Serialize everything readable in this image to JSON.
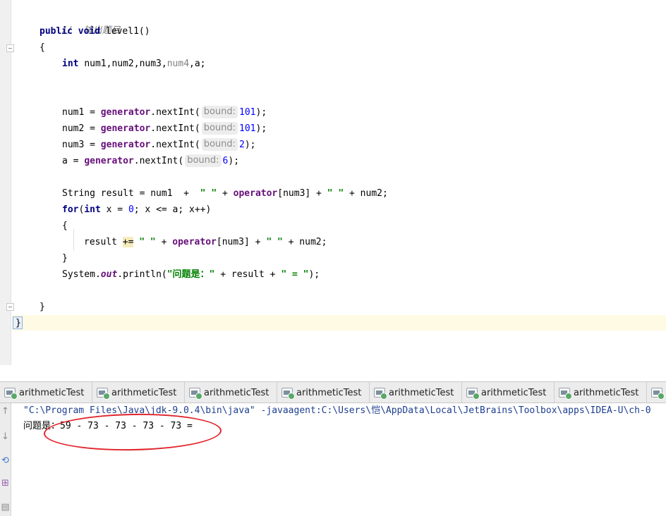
{
  "editor": {
    "comment": "//  输出题目",
    "method_decl": {
      "kw1": "public",
      "kw2": "void",
      "name": "level1()"
    },
    "open_brace": "{",
    "decl": {
      "type": "int",
      "vars": "num1,num2,num3,",
      "unused": "num4",
      "tail": ",a;"
    },
    "gen_lines": [
      {
        "lhs": "num1 = ",
        "field": "generator",
        "call": ".nextInt(",
        "hint": "bound:",
        "value": "101",
        "end": ");"
      },
      {
        "lhs": "num2 = ",
        "field": "generator",
        "call": ".nextInt(",
        "hint": "bound:",
        "value": "101",
        "end": ");"
      },
      {
        "lhs": "num3 = ",
        "field": "generator",
        "call": ".nextInt(",
        "hint": "bound:",
        "value": "2",
        "end": ");"
      },
      {
        "lhs": "a = ",
        "field": "generator",
        "call": ".nextInt(",
        "hint": "bound:",
        "value": "6",
        "end": ");"
      }
    ],
    "result_line": {
      "p1": "String result = num1  + ",
      "s1": " \" \" ",
      "p2": "+ ",
      "field": "operator",
      "p3": "[num3] + ",
      "s2": "\" \"",
      "p4": " + num2;"
    },
    "for_line": {
      "kw": "for",
      "p1": "(",
      "kw2": "int",
      "p2": " x = ",
      "n1": "0",
      "p3": "; x <= a; x++)"
    },
    "for_open": "{",
    "loop_body": {
      "p1": "result ",
      "op": "+=",
      "s1": " \" \" ",
      "p2": "+ ",
      "field": "operator",
      "p3": "[num3] + ",
      "s2": "\" \"",
      "p4": " + num2;"
    },
    "for_close": "}",
    "print_line": {
      "p1": "System.",
      "stat": "out",
      "p2": ".println(",
      "s1": "\"问题是：\"",
      "p3": " + result + ",
      "s2": "\" = \"",
      "p4": ");"
    },
    "method_close": "}",
    "class_close": "}"
  },
  "run_panel": {
    "tabs": [
      "arithmeticTest",
      "arithmeticTest",
      "arithmeticTest",
      "arithmeticTest",
      "arithmeticTest",
      "arithmeticTest",
      "arithmeticTest",
      "a"
    ],
    "side_icons": [
      "up-arrow",
      "down-arrow",
      "rerun",
      "pin",
      "print"
    ],
    "console": {
      "command": "\"C:\\Program Files\\Java\\jdk-9.0.4\\bin\\java\" -javaagent:C:\\Users\\恺\\AppData\\Local\\JetBrains\\Toolbox\\apps\\IDEA-U\\ch-0",
      "output": "问题是：59 - 73 - 73 - 73 - 73 ="
    }
  },
  "colors": {
    "keyword": "#000080",
    "field": "#660e7a",
    "string": "#008000",
    "number": "#0000ff",
    "annotation_ellipse": "#e0252c"
  }
}
